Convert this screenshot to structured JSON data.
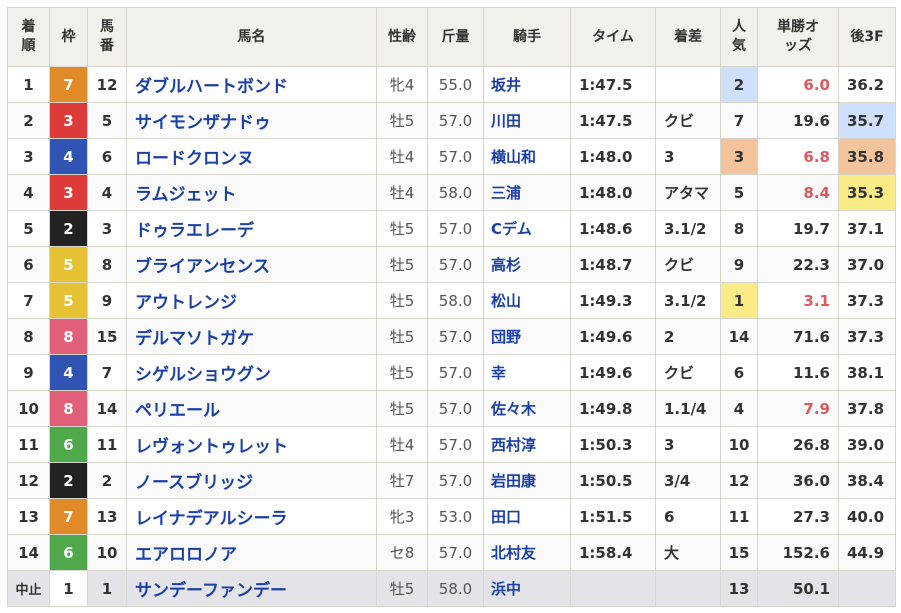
{
  "headers": {
    "rank": "着順",
    "frame": "枠",
    "num": "馬番",
    "name": "馬名",
    "sexage": "性齢",
    "weight": "斤量",
    "jockey": "騎手",
    "time": "タイム",
    "margin": "着差",
    "pop": "人気",
    "odds": "単勝オッズ",
    "last3f": "後3F"
  },
  "colors": {
    "frame1": "#ffffff",
    "frame2": "#222222",
    "frame3": "#dd3a3a",
    "frame4": "#2f54b3",
    "frame5": "#e4c233",
    "frame6": "#4fa84a",
    "frame7": "#e08a28",
    "frame8": "#e0607a",
    "link": "#1a3fa8",
    "odds_red": "#e0575c"
  },
  "rows": [
    {
      "rank": "1",
      "frame": "7",
      "num": "12",
      "name": "ダブルハートボンド",
      "sexage": "牝4",
      "weight": "55.0",
      "jockey": "坂井",
      "time": "1:47.5",
      "margin": "",
      "pop": "2",
      "odds": "6.0",
      "last3f": "36.2",
      "popHl": "blue",
      "oddsRed": true,
      "f3Hl": ""
    },
    {
      "rank": "2",
      "frame": "3",
      "num": "5",
      "name": "サイモンザナドゥ",
      "sexage": "牡5",
      "weight": "57.0",
      "jockey": "川田",
      "time": "1:47.5",
      "margin": "クビ",
      "pop": "7",
      "odds": "19.6",
      "last3f": "35.7",
      "popHl": "",
      "oddsRed": false,
      "f3Hl": "blue"
    },
    {
      "rank": "3",
      "frame": "4",
      "num": "6",
      "name": "ロードクロンヌ",
      "sexage": "牡4",
      "weight": "57.0",
      "jockey": "横山和",
      "time": "1:48.0",
      "margin": "3",
      "pop": "3",
      "odds": "6.8",
      "last3f": "35.8",
      "popHl": "orange",
      "oddsRed": true,
      "f3Hl": "orange"
    },
    {
      "rank": "4",
      "frame": "3",
      "num": "4",
      "name": "ラムジェット",
      "sexage": "牡4",
      "weight": "58.0",
      "jockey": "三浦",
      "time": "1:48.0",
      "margin": "アタマ",
      "pop": "5",
      "odds": "8.4",
      "last3f": "35.3",
      "popHl": "",
      "oddsRed": true,
      "f3Hl": "yellow"
    },
    {
      "rank": "5",
      "frame": "2",
      "num": "3",
      "name": "ドゥラエレーデ",
      "sexage": "牡5",
      "weight": "57.0",
      "jockey": "Cデム",
      "time": "1:48.6",
      "margin": "3.1/2",
      "pop": "8",
      "odds": "19.7",
      "last3f": "37.1",
      "popHl": "",
      "oddsRed": false,
      "f3Hl": ""
    },
    {
      "rank": "6",
      "frame": "5",
      "num": "8",
      "name": "ブライアンセンス",
      "sexage": "牡5",
      "weight": "57.0",
      "jockey": "高杉",
      "time": "1:48.7",
      "margin": "クビ",
      "pop": "9",
      "odds": "22.3",
      "last3f": "37.0",
      "popHl": "",
      "oddsRed": false,
      "f3Hl": ""
    },
    {
      "rank": "7",
      "frame": "5",
      "num": "9",
      "name": "アウトレンジ",
      "sexage": "牡5",
      "weight": "58.0",
      "jockey": "松山",
      "time": "1:49.3",
      "margin": "3.1/2",
      "pop": "1",
      "odds": "3.1",
      "last3f": "37.3",
      "popHl": "yellow",
      "oddsRed": true,
      "f3Hl": ""
    },
    {
      "rank": "8",
      "frame": "8",
      "num": "15",
      "name": "デルマソトガケ",
      "sexage": "牡5",
      "weight": "57.0",
      "jockey": "団野",
      "time": "1:49.6",
      "margin": "2",
      "pop": "14",
      "odds": "71.6",
      "last3f": "37.3",
      "popHl": "",
      "oddsRed": false,
      "f3Hl": ""
    },
    {
      "rank": "9",
      "frame": "4",
      "num": "7",
      "name": "シゲルショウグン",
      "sexage": "牡5",
      "weight": "57.0",
      "jockey": "幸",
      "time": "1:49.6",
      "margin": "クビ",
      "pop": "6",
      "odds": "11.6",
      "last3f": "38.1",
      "popHl": "",
      "oddsRed": false,
      "f3Hl": ""
    },
    {
      "rank": "10",
      "frame": "8",
      "num": "14",
      "name": "ペリエール",
      "sexage": "牡5",
      "weight": "57.0",
      "jockey": "佐々木",
      "time": "1:49.8",
      "margin": "1.1/4",
      "pop": "4",
      "odds": "7.9",
      "last3f": "37.8",
      "popHl": "",
      "oddsRed": true,
      "f3Hl": ""
    },
    {
      "rank": "11",
      "frame": "6",
      "num": "11",
      "name": "レヴォントゥレット",
      "sexage": "牡4",
      "weight": "57.0",
      "jockey": "西村淳",
      "time": "1:50.3",
      "margin": "3",
      "pop": "10",
      "odds": "26.8",
      "last3f": "39.0",
      "popHl": "",
      "oddsRed": false,
      "f3Hl": ""
    },
    {
      "rank": "12",
      "frame": "2",
      "num": "2",
      "name": "ノースブリッジ",
      "sexage": "牡7",
      "weight": "57.0",
      "jockey": "岩田康",
      "time": "1:50.5",
      "margin": "3/4",
      "pop": "12",
      "odds": "36.0",
      "last3f": "38.4",
      "popHl": "",
      "oddsRed": false,
      "f3Hl": ""
    },
    {
      "rank": "13",
      "frame": "7",
      "num": "13",
      "name": "レイナデアルシーラ",
      "sexage": "牝3",
      "weight": "53.0",
      "jockey": "田口",
      "time": "1:51.5",
      "margin": "6",
      "pop": "11",
      "odds": "27.3",
      "last3f": "40.0",
      "popHl": "",
      "oddsRed": false,
      "f3Hl": ""
    },
    {
      "rank": "14",
      "frame": "6",
      "num": "10",
      "name": "エアロロノア",
      "sexage": "セ8",
      "weight": "57.0",
      "jockey": "北村友",
      "time": "1:58.4",
      "margin": "大",
      "pop": "15",
      "odds": "152.6",
      "last3f": "44.9",
      "popHl": "",
      "oddsRed": false,
      "f3Hl": ""
    },
    {
      "rank": "中止",
      "frame": "1",
      "num": "1",
      "name": "サンデーファンデー",
      "sexage": "牡5",
      "weight": "58.0",
      "jockey": "浜中",
      "time": "",
      "margin": "",
      "pop": "13",
      "odds": "50.1",
      "last3f": "",
      "popHl": "",
      "oddsRed": false,
      "f3Hl": "",
      "stop": true
    }
  ]
}
